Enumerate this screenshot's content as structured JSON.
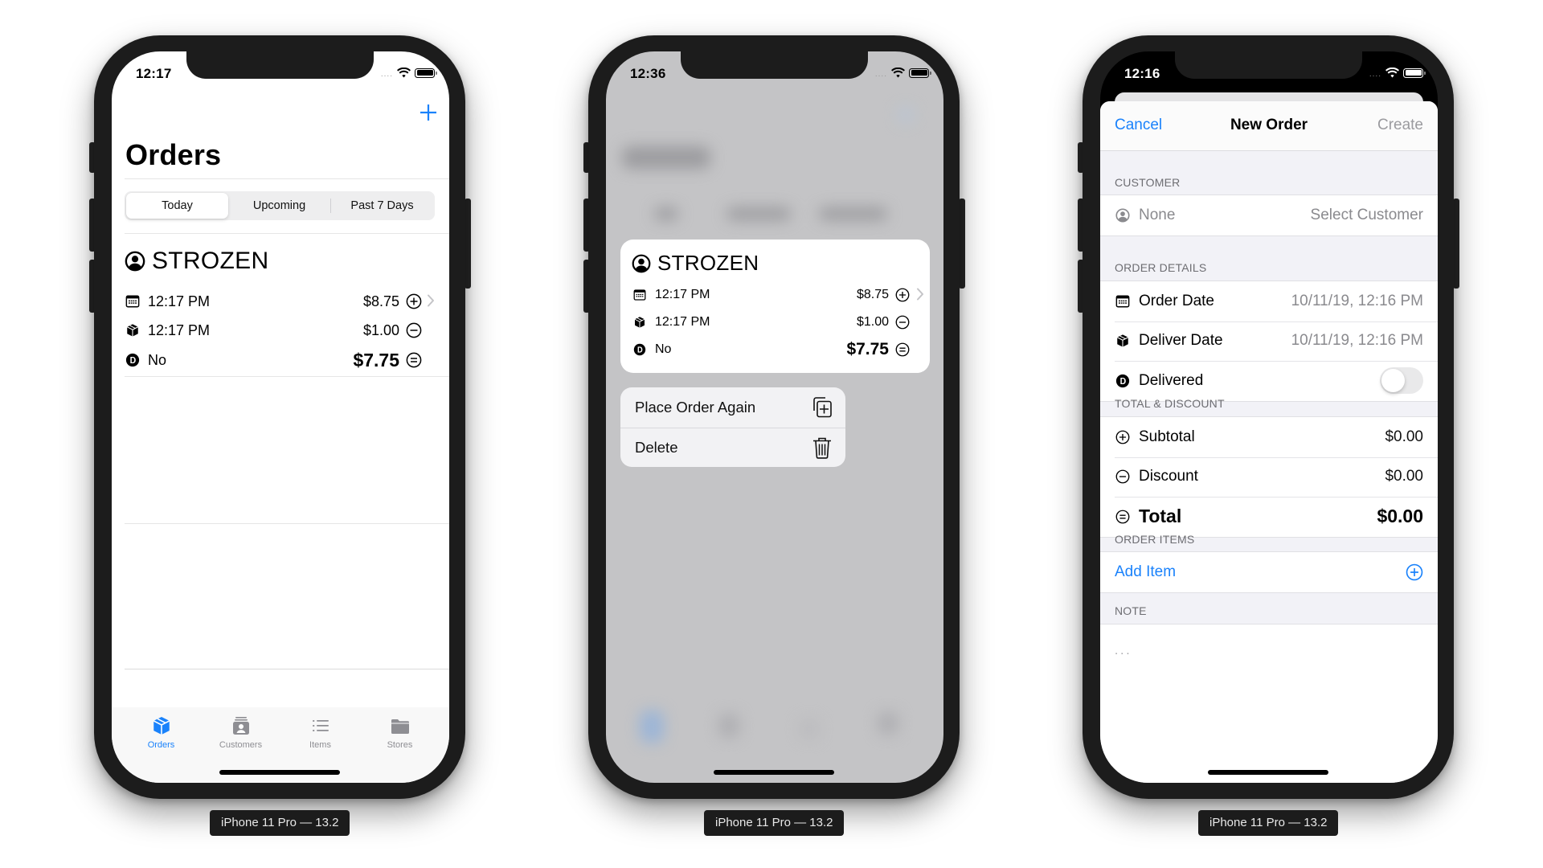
{
  "devices": [
    {
      "label": "iPhone 11 Pro — 13.2",
      "status_time": "12:17",
      "screen": "orders_list",
      "nav": {
        "title": "Orders",
        "add_icon": "plus-icon"
      },
      "segments": [
        {
          "label": "Today",
          "selected": true
        },
        {
          "label": "Upcoming",
          "selected": false
        },
        {
          "label": "Past 7 Days",
          "selected": false
        }
      ],
      "order": {
        "customer": "STROZEN",
        "order_time": "12:17 PM",
        "deliver_time": "12:17 PM",
        "delivered": "No",
        "subtotal": "$8.75",
        "discount": "$1.00",
        "total": "$7.75"
      },
      "tabs": [
        {
          "label": "Orders",
          "icon": "cube-box-icon",
          "active": true
        },
        {
          "label": "Customers",
          "icon": "person-card-icon",
          "active": false
        },
        {
          "label": "Items",
          "icon": "list-icon",
          "active": false
        },
        {
          "label": "Stores",
          "icon": "folder-icon",
          "active": false
        }
      ]
    },
    {
      "label": "iPhone 11 Pro — 13.2",
      "status_time": "12:36",
      "screen": "context_menu",
      "order": {
        "customer": "STROZEN",
        "order_time": "12:17 PM",
        "deliver_time": "12:17 PM",
        "delivered": "No",
        "subtotal": "$8.75",
        "discount": "$1.00",
        "total": "$7.75"
      },
      "menu": [
        {
          "label": "Place Order Again",
          "icon": "plus-square-on-square-icon"
        },
        {
          "label": "Delete",
          "icon": "trash-icon"
        }
      ]
    },
    {
      "label": "iPhone 11 Pro — 13.2",
      "status_time": "12:16",
      "screen": "new_order_form",
      "nav": {
        "cancel": "Cancel",
        "title": "New Order",
        "create": "Create"
      },
      "sections": {
        "customer": {
          "header": "CUSTOMER",
          "value": "None",
          "action": "Select Customer"
        },
        "order_details": {
          "header": "ORDER DETAILS",
          "order_date_label": "Order Date",
          "order_date_value": "10/11/19, 12:16 PM",
          "deliver_date_label": "Deliver Date",
          "deliver_date_value": "10/11/19, 12:16 PM",
          "delivered_label": "Delivered",
          "delivered_on": false
        },
        "total_discount": {
          "header": "TOTAL & DISCOUNT",
          "subtotal_label": "Subtotal",
          "subtotal_value": "$0.00",
          "discount_label": "Discount",
          "discount_value": "$0.00",
          "total_label": "Total",
          "total_value": "$0.00"
        },
        "order_items": {
          "header": "ORDER ITEMS",
          "add_label": "Add Item"
        },
        "note": {
          "header": "NOTE",
          "placeholder": "..."
        }
      }
    }
  ],
  "colors": {
    "accent": "#1a82fb",
    "bezel": "#1c1c1c",
    "grouped_bg": "#f2f2f7",
    "secondary_text": "#8a8a8e"
  }
}
